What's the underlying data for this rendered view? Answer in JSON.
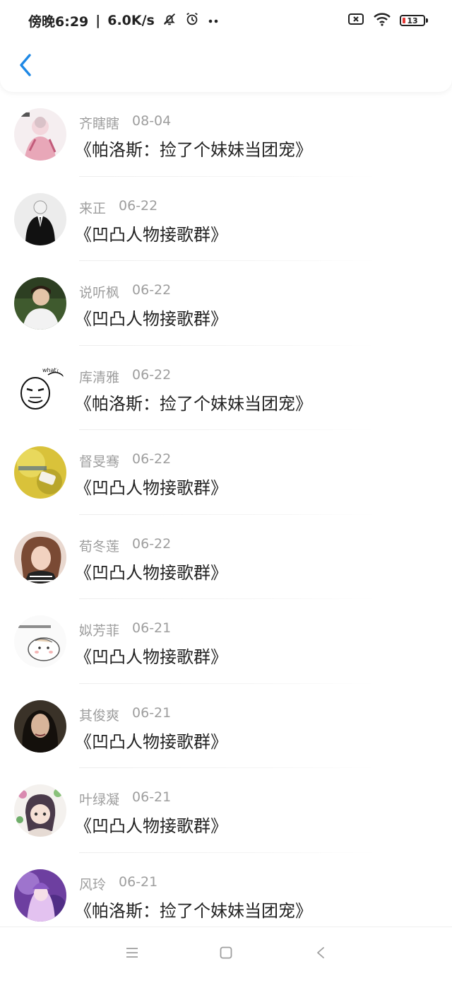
{
  "status_bar": {
    "carrier": "傍晚6:29",
    "speed": "6.0K/s",
    "battery_level": "13",
    "battery_color": "#e53935"
  },
  "nav": {
    "back_icon": "chevron-left-icon",
    "accent_color": "#1e88e5"
  },
  "items": [
    {
      "name": "齐瞎瞎",
      "date": "08-04",
      "title": "《帕洛斯：捡了个妹妹当团宠》",
      "avatar": "avatar-anime-pink"
    },
    {
      "name": "来正",
      "date": "06-22",
      "title": "《凹凸人物接歌群》",
      "avatar": "avatar-suit"
    },
    {
      "name": "说听枫",
      "date": "06-22",
      "title": "《凹凸人物接歌群》",
      "avatar": "avatar-boy-green"
    },
    {
      "name": "库清雅",
      "date": "06-22",
      "title": "《帕洛斯：捡了个妹妹当团宠》",
      "avatar": "avatar-meme-face"
    },
    {
      "name": "督旻骞",
      "date": "06-22",
      "title": "《凹凸人物接歌群》",
      "avatar": "avatar-yellow"
    },
    {
      "name": "荀冬莲",
      "date": "06-22",
      "title": "《凹凸人物接歌群》",
      "avatar": "avatar-girl-selfie"
    },
    {
      "name": "姒芳菲",
      "date": "06-21",
      "title": "《凹凸人物接歌群》",
      "avatar": "avatar-hamster"
    },
    {
      "name": "其俊爽",
      "date": "06-21",
      "title": "《凹凸人物接歌群》",
      "avatar": "avatar-girl-dark"
    },
    {
      "name": "叶绿凝",
      "date": "06-21",
      "title": "《凹凸人物接歌群》",
      "avatar": "avatar-anime-flowers"
    },
    {
      "name": "风玲",
      "date": "06-21",
      "title": "《帕洛斯：捡了个妹妹当团宠》",
      "avatar": "avatar-anime-purple"
    }
  ],
  "system_nav": {
    "menu_icon": "menu-icon",
    "home_icon": "square-home-icon",
    "back_icon": "back-triangle-icon"
  }
}
